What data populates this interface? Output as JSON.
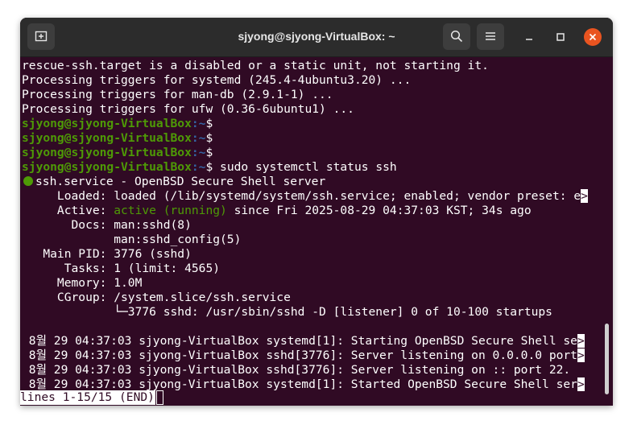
{
  "window": {
    "title": "sjyong@sjyong-VirtualBox: ~",
    "new_tab_icon": "new-tab-icon",
    "search_icon": "search-icon",
    "menu_icon": "hamburger-menu-icon"
  },
  "prompt": {
    "user_host": "sjyong@sjyong-VirtualBox",
    "path_part": ":~",
    "dollar": "$",
    "command": " sudo systemctl status ssh"
  },
  "output_lines": [
    "rescue-ssh.target is a disabled or a static unit, not starting it.",
    "Processing triggers for systemd (245.4-4ubuntu3.20) ...",
    "Processing triggers for man-db (2.9.1-1) ...",
    "Processing triggers for ufw (0.36-6ubuntu1) ..."
  ],
  "status": {
    "service_line": "ssh.service - OpenBSD Secure Shell server",
    "loaded": "     Loaded: loaded (/lib/systemd/system/ssh.service; enabled; vendor preset: e",
    "active_prefix": "     Active: ",
    "active_state": "active (running)",
    "active_suffix": " since Fri 2025-08-29 04:37:03 KST; 34s ago",
    "docs1": "       Docs: man:sshd(8)",
    "docs2": "             man:sshd_config(5)",
    "main_pid": "   Main PID: 3776 (sshd)",
    "tasks": "      Tasks: 1 (limit: 4565)",
    "memory": "     Memory: 1.0M",
    "cgroup": "     CGroup: /system.slice/ssh.service",
    "cgroup_child": "             └─3776 sshd: /usr/sbin/sshd -D [listener] 0 of 10-100 startups"
  },
  "log_lines": [
    " 8월 29 04:37:03 sjyong-VirtualBox systemd[1]: Starting OpenBSD Secure Shell se",
    " 8월 29 04:37:03 sjyong-VirtualBox sshd[3776]: Server listening on 0.0.0.0 port",
    " 8월 29 04:37:03 sjyong-VirtualBox sshd[3776]: Server listening on :: port 22.",
    " 8월 29 04:37:03 sjyong-VirtualBox systemd[1]: Started OpenBSD Secure Shell ser"
  ],
  "truncation_marker": ">",
  "pager_status": "lines 1-15/15 (END)"
}
